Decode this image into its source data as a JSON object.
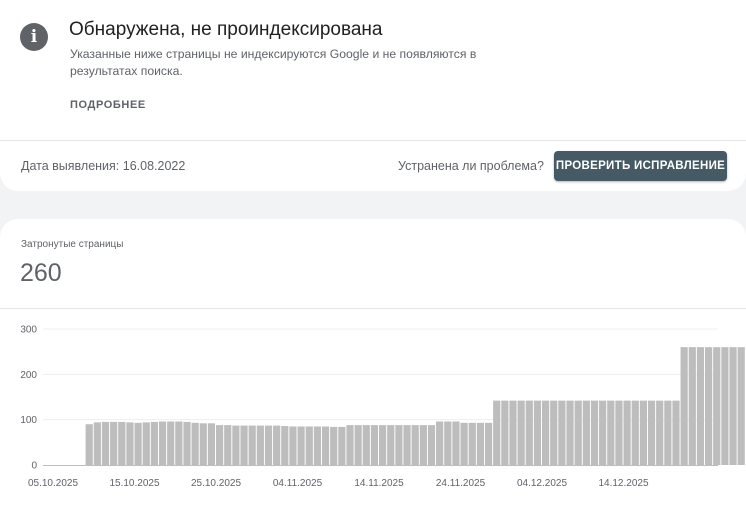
{
  "issue": {
    "title": "Обнаружена, не проиндексирована",
    "description": "Указанные ниже страницы не индексируются Google и не появляются в результатах поиска.",
    "more_label": "ПОДРОБНЕЕ",
    "icon": "info-icon",
    "icon_glyph": "i",
    "detected_text": "Дата выявления: 16.08.2022",
    "fixed_question": "Устранена ли проблема?",
    "validate_label": "ПРОВЕРИТЬ ИСПРАВЛЕНИЕ"
  },
  "metric": {
    "label": "Затронутые страницы",
    "value": "260"
  },
  "colors": {
    "bar": "#bdbdbd",
    "button": "#455a64",
    "grid": "#eceff1",
    "axis": "#bdbdbd",
    "tick_text": "#5f6368"
  },
  "chart_data": {
    "type": "bar",
    "title": "",
    "xlabel": "",
    "ylabel": "",
    "ylim": [
      0,
      300
    ],
    "y_ticks": [
      0,
      100,
      200,
      300
    ],
    "grid": true,
    "x_tick_labels": [
      "05.10.2025",
      "15.10.2025",
      "25.10.2025",
      "04.11.2025",
      "14.11.2025",
      "24.11.2025",
      "04.12.2025",
      "14.12.2025"
    ],
    "x_tick_indices": [
      0,
      10,
      20,
      30,
      40,
      50,
      60,
      70
    ],
    "values": [
      0,
      0,
      0,
      0,
      90,
      94,
      95,
      95,
      95,
      94,
      93,
      94,
      95,
      96,
      96,
      96,
      95,
      93,
      92,
      92,
      88,
      88,
      87,
      87,
      87,
      87,
      87,
      87,
      86,
      85,
      85,
      85,
      85,
      85,
      84,
      84,
      88,
      88,
      88,
      88,
      88,
      88,
      88,
      88,
      88,
      88,
      88,
      96,
      96,
      96,
      93,
      93,
      93,
      93,
      142,
      142,
      142,
      142,
      142,
      142,
      142,
      142,
      142,
      142,
      142,
      142,
      142,
      142,
      142,
      142,
      142,
      142,
      142,
      142,
      142,
      142,
      142,
      260,
      260,
      260,
      260,
      260,
      260,
      260,
      260
    ]
  }
}
